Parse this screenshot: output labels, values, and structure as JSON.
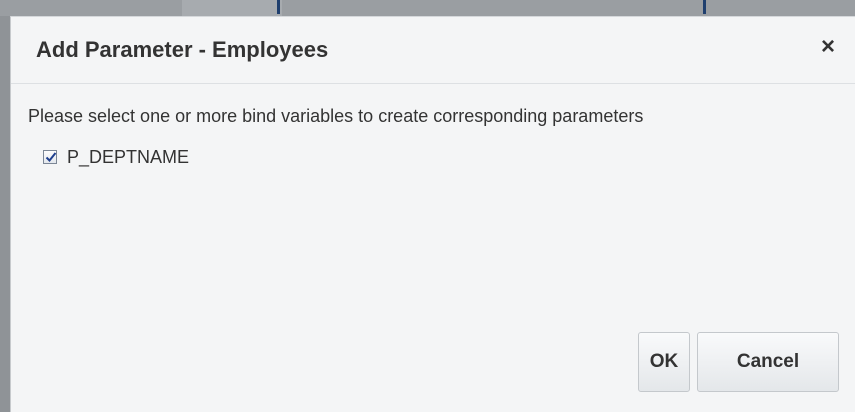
{
  "dialog": {
    "title": "Add Parameter - Employees",
    "close_glyph": "×",
    "instructions": "Please select one or more bind variables to create corresponding parameters",
    "bind_variables": [
      {
        "label": "P_DEPTNAME",
        "checked": true
      }
    ],
    "ok_label": "OK",
    "cancel_label": "Cancel"
  },
  "colors": {
    "dialog_background": "#f4f5f6",
    "text": "#333333",
    "backdrop": "#8f9397",
    "checkmark": "#1f3f8e"
  },
  "icons": {
    "close": "close-icon",
    "checkbox": "checkbox-checked-icon"
  }
}
